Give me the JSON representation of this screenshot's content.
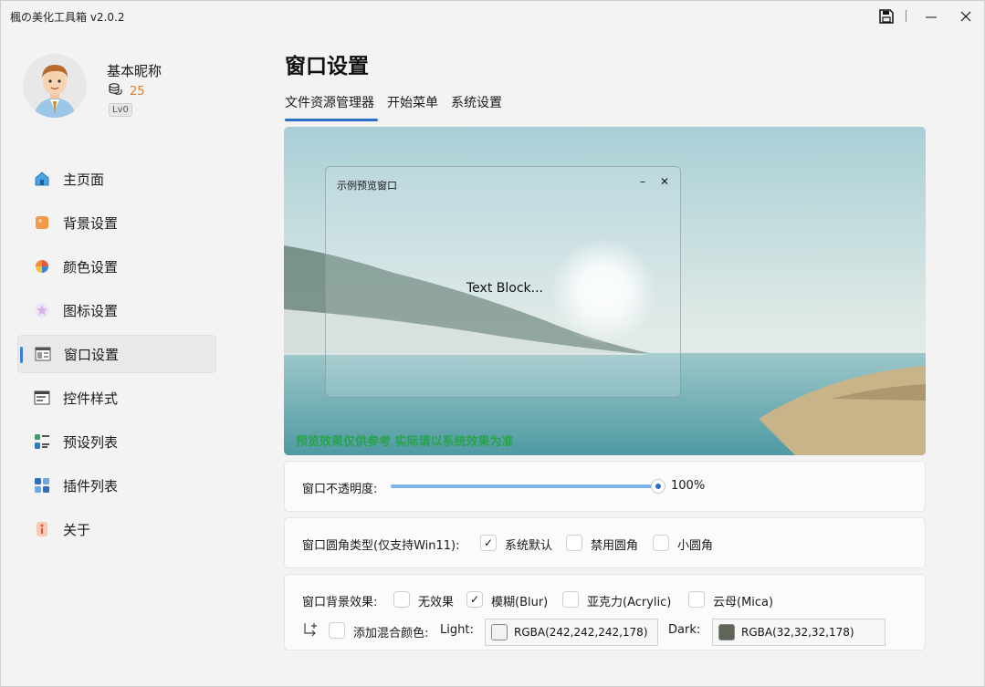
{
  "app": {
    "title": "楓の美化工具箱 v2.0.2",
    "icons": {
      "save": "save-icon",
      "minimize": "minimize-icon",
      "close": "close-icon"
    }
  },
  "user": {
    "nickname": "基本昵称",
    "coins": "25",
    "level": "Lv0",
    "coin_icon": "coin-stack-icon"
  },
  "sidebar": {
    "items": [
      {
        "label": "主页面",
        "icon": "home-icon"
      },
      {
        "label": "背景设置",
        "icon": "background-icon"
      },
      {
        "label": "颜色设置",
        "icon": "palette-icon"
      },
      {
        "label": "图标设置",
        "icon": "star-icon"
      },
      {
        "label": "窗口设置",
        "icon": "window-icon",
        "active": true
      },
      {
        "label": "控件样式",
        "icon": "controls-icon"
      },
      {
        "label": "预设列表",
        "icon": "preset-list-icon"
      },
      {
        "label": "插件列表",
        "icon": "plugins-icon"
      },
      {
        "label": "关于",
        "icon": "about-icon"
      }
    ]
  },
  "main": {
    "title": "窗口设置",
    "tabs": [
      {
        "label": "文件资源管理器",
        "active": true
      },
      {
        "label": "开始菜单"
      },
      {
        "label": "系统设置"
      }
    ],
    "preview": {
      "window_title": "示例预览窗口",
      "text_block": "Text Block...",
      "note": "预览效果仅供参考 实际请以系统效果为准"
    },
    "opacity": {
      "label": "窗口不透明度:",
      "value": "100%",
      "fraction": 1.0
    },
    "corner": {
      "label": "窗口圆角类型(仅支持Win11):",
      "options": [
        {
          "label": "系统默认",
          "checked": true
        },
        {
          "label": "禁用圆角",
          "checked": false
        },
        {
          "label": "小圆角",
          "checked": false
        }
      ]
    },
    "backdrop": {
      "label": "窗口背景效果:",
      "options": [
        {
          "label": "无效果",
          "checked": false
        },
        {
          "label": "模糊(Blur)",
          "checked": true
        },
        {
          "label": "亚克力(Acrylic)",
          "checked": false
        },
        {
          "label": "云母(Mica)",
          "checked": false
        }
      ],
      "blend_label": "添加混合颜色:",
      "blend_checked": false,
      "light_label": "Light:",
      "light_value": "RGBA(242,242,242,178)",
      "light_color": "#f2f2f2",
      "dark_label": "Dark:",
      "dark_value": "RGBA(32,32,32,178)",
      "dark_color": "#5e6559",
      "sub_icon": "sub-item-arrow-icon"
    }
  },
  "colors": {
    "accent": "#2a6ec5",
    "note_green": "#27a44a",
    "coin_orange": "#e07b2a"
  }
}
